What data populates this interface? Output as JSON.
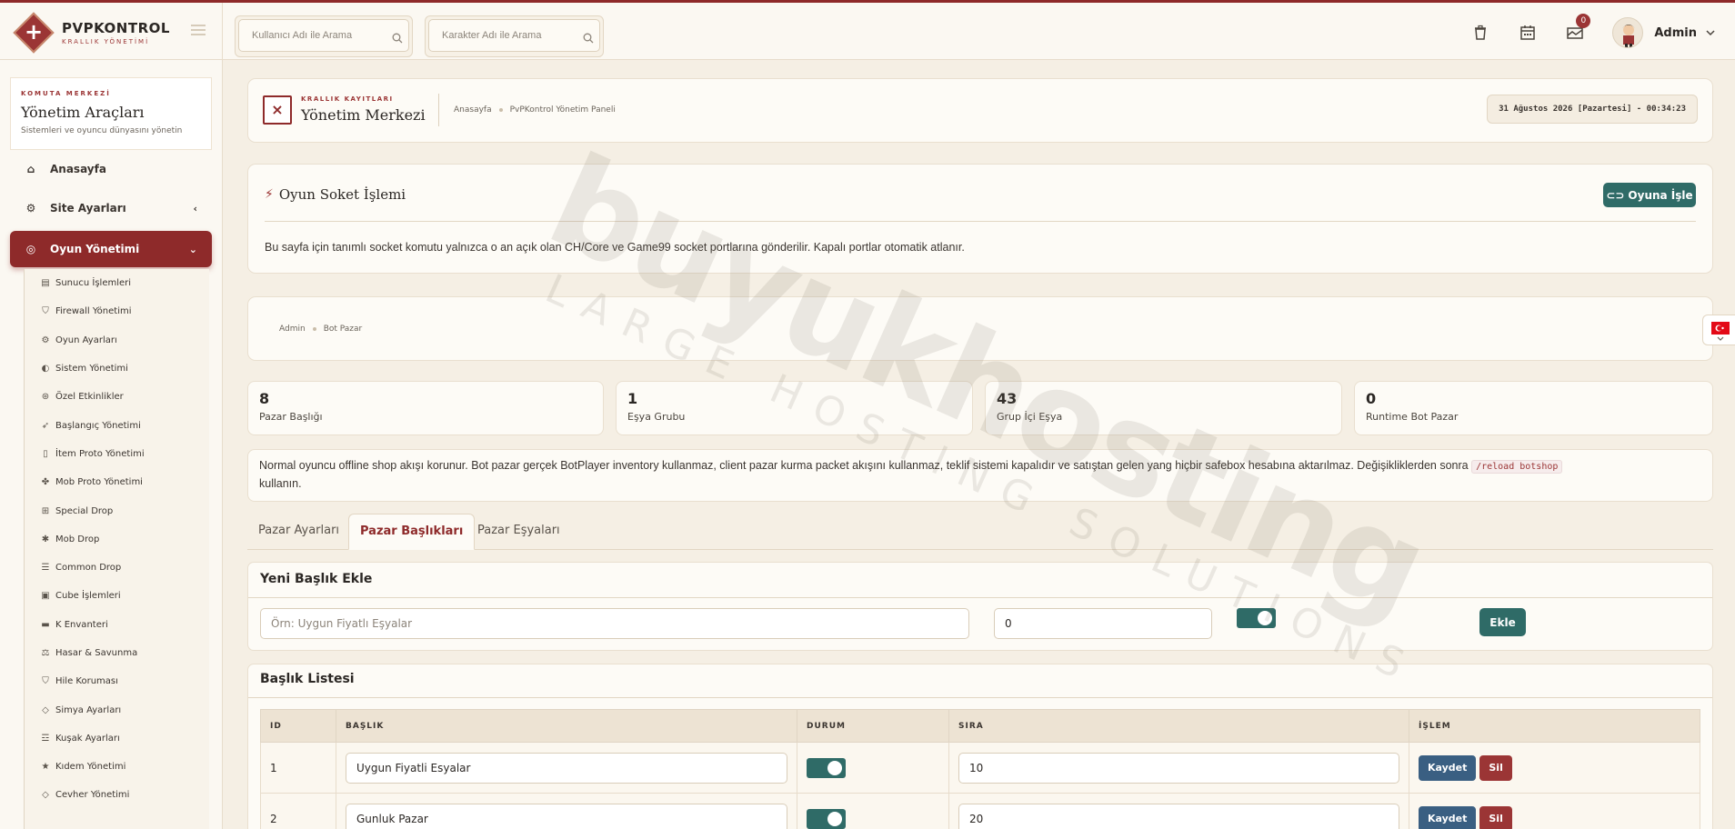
{
  "brand": {
    "title": "PVPKONTROL",
    "subtitle": "KRALLIK YÖNETİMİ"
  },
  "search": {
    "user_placeholder": "Kullanıcı Adı ile Arama",
    "char_placeholder": "Karakter Adı ile Arama"
  },
  "topbar": {
    "mail_badge": "0",
    "admin_name": "Admin"
  },
  "sidebar": {
    "kicker": "KOMUTA MERKEZİ",
    "title": "Yönetim Araçları",
    "desc": "Sistemleri ve oyuncu dünyasını yönetin",
    "nav": [
      {
        "label": "Anasayfa",
        "icon": "home-icon"
      },
      {
        "label": "Site Ayarları",
        "icon": "gear-icon"
      },
      {
        "label": "Oyun Yönetimi",
        "icon": "gamepad-icon"
      }
    ],
    "submenu": [
      {
        "label": "Sunucu İşlemleri",
        "icon": "server-icon",
        "glyph": "▤"
      },
      {
        "label": "Firewall Yönetimi",
        "icon": "shield-icon",
        "glyph": "⛉"
      },
      {
        "label": "Oyun Ayarları",
        "icon": "cogs-icon",
        "glyph": "⚙"
      },
      {
        "label": "Sistem Yönetimi",
        "icon": "toggle-icon",
        "glyph": "◐"
      },
      {
        "label": "Özel Etkinlikler",
        "icon": "gamepad-icon",
        "glyph": "⊛"
      },
      {
        "label": "Başlangıç Yönetimi",
        "icon": "rocket-icon",
        "glyph": "➶"
      },
      {
        "label": "İtem Proto Yönetimi",
        "icon": "file-icon",
        "glyph": "▯"
      },
      {
        "label": "Mob Proto Yönetimi",
        "icon": "paw-icon",
        "glyph": "✤"
      },
      {
        "label": "Special Drop",
        "icon": "gift-icon",
        "glyph": "⊞"
      },
      {
        "label": "Mob Drop",
        "icon": "bug-icon",
        "glyph": "✱"
      },
      {
        "label": "Common Drop",
        "icon": "list-icon",
        "glyph": "☰"
      },
      {
        "label": "Cube İşlemleri",
        "icon": "cube-icon",
        "glyph": "▣"
      },
      {
        "label": "K Envanteri",
        "icon": "inventory-icon",
        "glyph": "▬"
      },
      {
        "label": "Hasar & Savunma",
        "icon": "scale-icon",
        "glyph": "⚖"
      },
      {
        "label": "Hile Koruması",
        "icon": "shield-icon",
        "glyph": "⛉"
      },
      {
        "label": "Simya Ayarları",
        "icon": "gem-icon",
        "glyph": "◇"
      },
      {
        "label": "Kuşak Ayarları",
        "icon": "belt-icon",
        "glyph": "☲"
      },
      {
        "label": "Kıdem Yönetimi",
        "icon": "star-icon",
        "glyph": "★"
      },
      {
        "label": "Cevher Yönetimi",
        "icon": "gem-icon",
        "glyph": "◇"
      }
    ]
  },
  "header": {
    "kicker": "KRALLIK KAYITLARI",
    "title": "Yönetim Merkezi",
    "crumb1": "Anasayfa",
    "crumb2": "PvPKontrol Yönetim Paneli",
    "datetime": "31 Ağustos 2026 [Pazartesi] - 00:34:23"
  },
  "socket": {
    "title": "Oyun Soket İşlemi",
    "button": "Oyuna İşle",
    "text": "Bu sayfa için tanımlı socket komutu yalnızca o an açık olan CH/Core ve Game99 socket portlarına gönderilir. Kapalı portlar otomatik atlanır."
  },
  "breadcrumb": {
    "a": "Admin",
    "b": "Bot Pazar"
  },
  "stats": [
    {
      "num": "8",
      "label": "Pazar Başlığı"
    },
    {
      "num": "1",
      "label": "Eşya Grubu"
    },
    {
      "num": "43",
      "label": "Grup İçi Eşya"
    },
    {
      "num": "0",
      "label": "Runtime Bot Pazar"
    }
  ],
  "info": {
    "text": "Normal oyuncu offline shop akışı korunur. Bot pazar gerçek BotPlayer inventory kullanmaz, client pazar kurma packet akışını kullanmaz, teklif sistemi kapalıdır ve satıştan gelen yang hiçbir safebox hesabına aktarılmaz. Değişikliklerden sonra",
    "code": "/reload botshop",
    "tail": "kullanın."
  },
  "tabs": [
    "Pazar Ayarları",
    "Pazar Başlıkları",
    "Pazar Eşyaları"
  ],
  "new_title": {
    "heading": "Yeni Başlık Ekle",
    "placeholder": "Örn: Uygun Fiyatlı Eşyalar",
    "order_value": "0",
    "enabled": true,
    "button": "Ekle"
  },
  "list": {
    "heading": "Başlık Listesi",
    "columns": [
      "ID",
      "BAŞLIK",
      "DURUM",
      "SIRA",
      "İŞLEM"
    ],
    "rows": [
      {
        "id": "1",
        "title": "Uygun Fiyatli Esyalar",
        "enabled": true,
        "order": "10"
      },
      {
        "id": "2",
        "title": "Gunluk Pazar",
        "enabled": true,
        "order": "20"
      }
    ],
    "save_label": "Kaydet",
    "delete_label": "Sil"
  },
  "watermark": {
    "line1": "buyukhosting",
    "line2": "LARGE HOSTING SOLUTIONS"
  },
  "colors": {
    "accent": "#8e2a2a",
    "green": "#2f6b67",
    "save": "#3a5f82",
    "background": "#f5efe4"
  }
}
